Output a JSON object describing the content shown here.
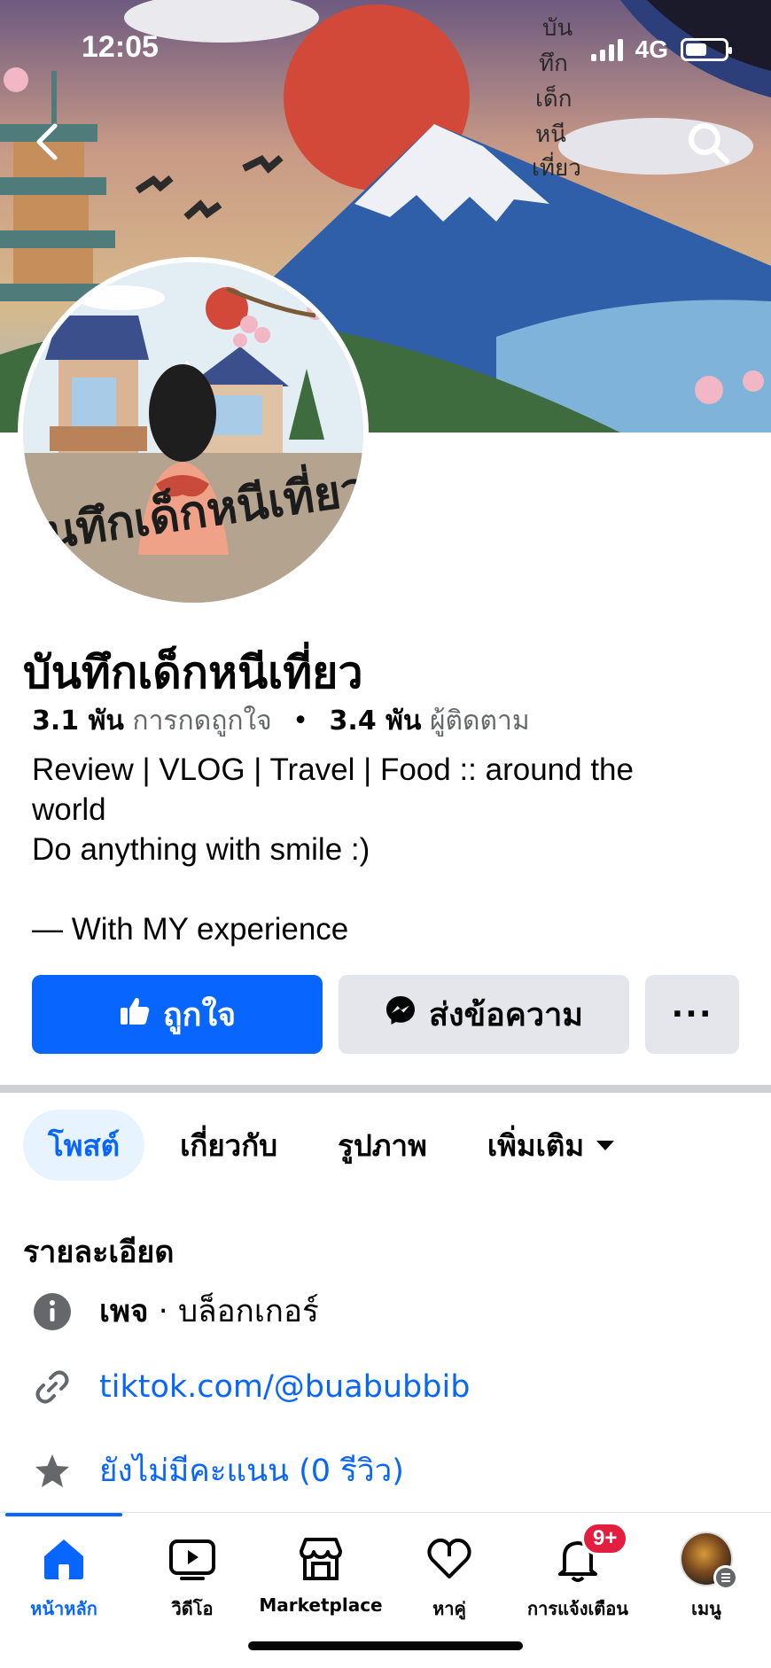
{
  "status_bar": {
    "time": "12:05",
    "network": "4G"
  },
  "cover": {
    "calligraphy": "บันทึกเด็กหนีเที่ยว"
  },
  "avatar": {
    "logo_text": "บันทึกเด็กหนีเที่ยว"
  },
  "profile": {
    "name": "บันทึกเด็กหนีเที่ยว",
    "likes_count": "3.1 พัน",
    "likes_label": "การกดถูกใจ",
    "separator": "•",
    "followers_count": "3.4 พัน",
    "followers_label": "ผู้ติดตาม",
    "bio": [
      "Review | VLOG | Travel | Food :: around the",
      "world",
      "Do anything with smile :)",
      "",
      "— With MY experience"
    ]
  },
  "actions": {
    "like_label": "ถูกใจ",
    "message_label": "ส่งข้อความ",
    "more_label": "···"
  },
  "tabs": [
    {
      "label": "โพสต์",
      "active": true
    },
    {
      "label": "เกี่ยวกับ",
      "active": false
    },
    {
      "label": "รูปภาพ",
      "active": false
    },
    {
      "label": "เพิ่มเติม",
      "active": false
    }
  ],
  "details": {
    "title": "รายละเอียด",
    "category_type": "เพจ",
    "category_sep": " · ",
    "category_value": "บล็อกเกอร์",
    "link": "tiktok.com/@buabubbib",
    "rating": "ยังไม่มีคะแนน (0 รีวิว)"
  },
  "bottom_nav": [
    {
      "label": "หน้าหลัก",
      "icon": "home-icon",
      "active": true
    },
    {
      "label": "วิดีโอ",
      "icon": "video-icon",
      "active": false
    },
    {
      "label": "Marketplace",
      "icon": "marketplace-icon",
      "active": false
    },
    {
      "label": "หาคู่",
      "icon": "dating-icon",
      "active": false
    },
    {
      "label": "การแจ้งเตือน",
      "icon": "bell-icon",
      "active": false,
      "badge": "9+"
    },
    {
      "label": "เมนู",
      "icon": "menu-avatar",
      "active": false
    }
  ],
  "colors": {
    "accent": "#0866ff",
    "badge": "#e41e3f",
    "secondary_button": "#e4e6eb"
  }
}
